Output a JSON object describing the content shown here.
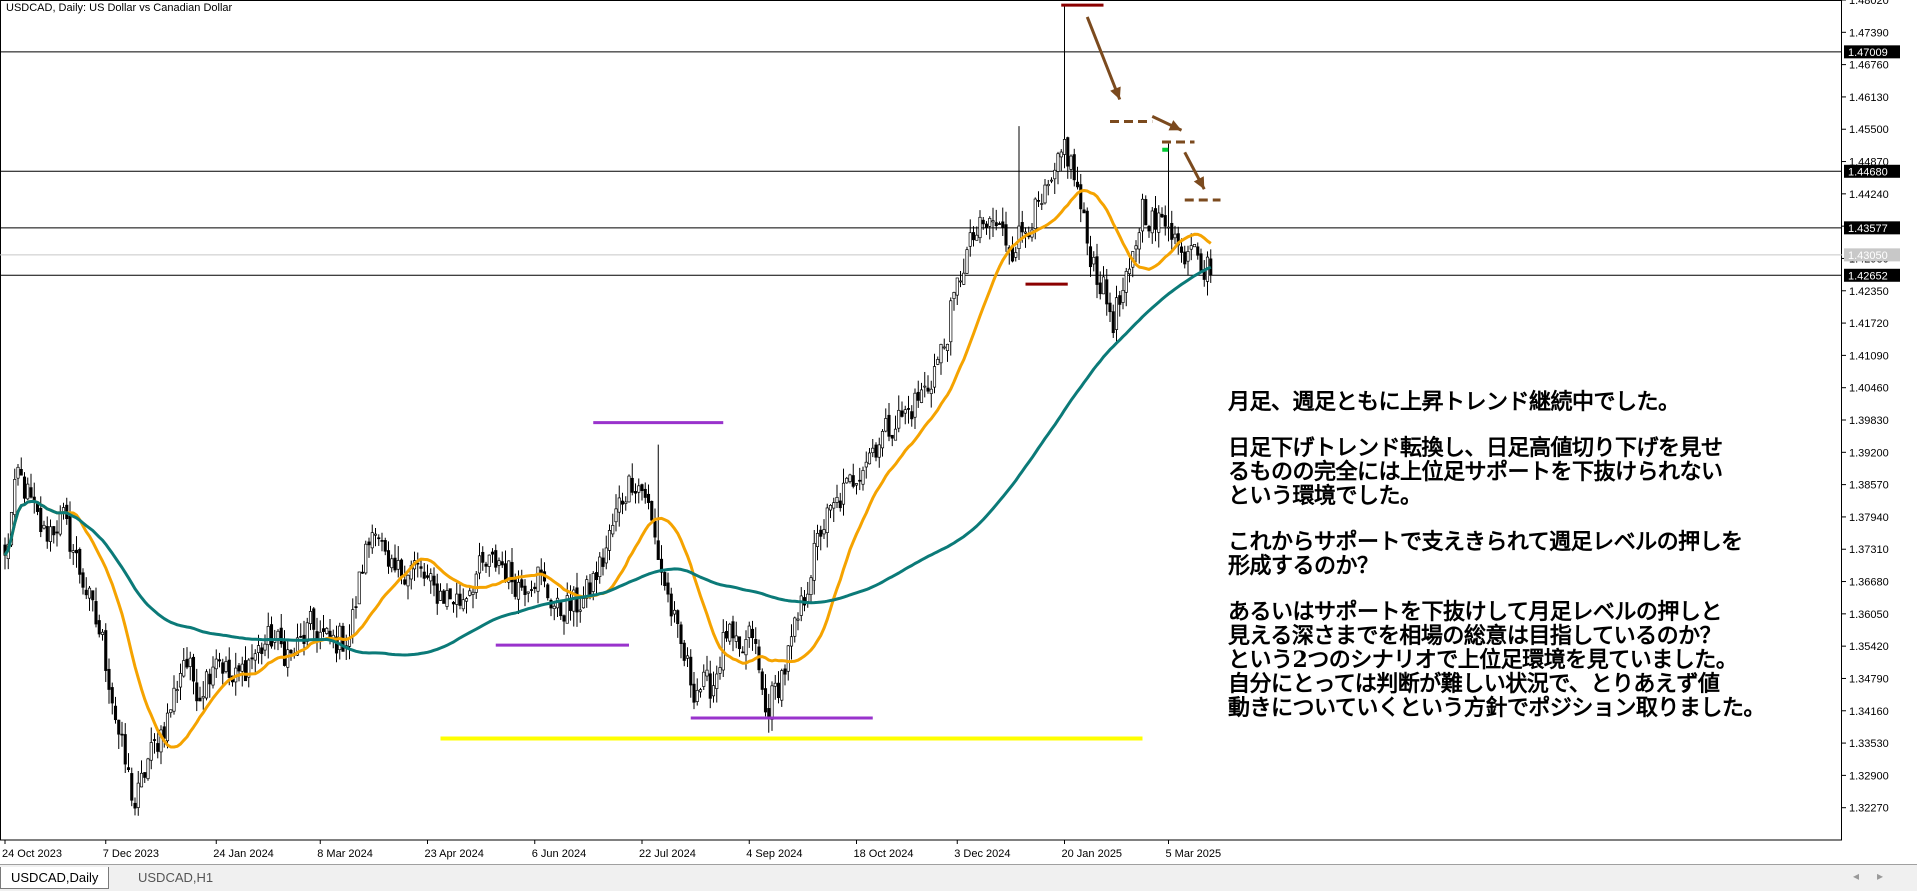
{
  "window": {
    "title": "USDCAD, Daily:  US Dollar vs Canadian Dollar"
  },
  "tabs": [
    {
      "label": "USDCAD,Daily",
      "active": true
    },
    {
      "label": "USDCAD,H1",
      "active": false
    }
  ],
  "memo": {
    "paragraphs": [
      [
        "月足、週足ともに上昇トレンド継続中でした。"
      ],
      [
        "日足下げトレンド転換し、日足高値切り下げを見せ",
        "るものの完全には上位足サポートを下抜けられない",
        "という環境でした。"
      ],
      [
        "これからサポートで支えきられて週足レベルの押しを",
        "形成するのか？"
      ],
      [
        "あるいはサポートを下抜けして月足レベルの押しと",
        "見える深さまでを相場の総意は目指しているのか？",
        "という2つのシナリオで上位足環境を見ていました。",
        "自分にとっては判断が難しい状況で、とりあえず値",
        "動きについていくという方針でポジション取りました。"
      ]
    ]
  },
  "colors": {
    "bull": "#ffffff",
    "bear": "#000000",
    "ma_fast": "#f5a300",
    "ma_slow": "#0b7a78",
    "support_yellow": "#ffff00",
    "range_purple": "#9933cc",
    "peak_red": "#8b0000",
    "arrow_brown": "#7b4a1e",
    "current_marker": "#00cc33"
  },
  "chart_data": {
    "type": "candlestick",
    "symbol": "USDCAD",
    "timeframe": "Daily",
    "ylim": [
      1.3164,
      1.4802
    ],
    "y_ticks": [
      1.4802,
      1.4739,
      1.4676,
      1.4613,
      1.455,
      1.4487,
      1.4424,
      1.4361,
      1.4298,
      1.4235,
      1.4172,
      1.4109,
      1.4046,
      1.3983,
      1.392,
      1.3857,
      1.3794,
      1.3731,
      1.3668,
      1.3605,
      1.3542,
      1.3479,
      1.3416,
      1.3353,
      1.329,
      1.3227
    ],
    "y_tick_labels": [
      "1.48020",
      "1.47390",
      "1.46760",
      "1.46130",
      "1.45500",
      "1.44870",
      "1.44240",
      "1.43610",
      "1.42980",
      "1.42350",
      "1.41720",
      "1.41090",
      "1.40460",
      "1.39830",
      "1.39200",
      "1.38570",
      "1.37940",
      "1.37310",
      "1.36680",
      "1.36050",
      "1.35420",
      "1.34790",
      "1.34160",
      "1.33530",
      "1.32900",
      "1.32270"
    ],
    "x_tick_labels": [
      "24 Oct 2023",
      "7 Dec 2023",
      "24 Jan 2024",
      "8 Mar 2024",
      "23 Apr 2024",
      "6 Jun 2024",
      "22 Jul 2024",
      "4 Sep 2024",
      "18 Oct 2024",
      "3 Dec 2024",
      "20 Jan 2025",
      "5 Mar 2025"
    ],
    "x_tick_index": [
      0,
      31,
      65,
      97,
      130,
      163,
      196,
      229,
      262,
      293,
      326,
      358
    ],
    "total_bars": 430,
    "waypoints": [
      [
        0,
        1.371
      ],
      [
        4,
        1.388
      ],
      [
        12,
        1.376
      ],
      [
        18,
        1.379
      ],
      [
        24,
        1.367
      ],
      [
        30,
        1.355
      ],
      [
        35,
        1.337
      ],
      [
        40,
        1.323
      ],
      [
        44,
        1.332
      ],
      [
        50,
        1.34
      ],
      [
        55,
        1.352
      ],
      [
        60,
        1.345
      ],
      [
        65,
        1.353
      ],
      [
        70,
        1.347
      ],
      [
        76,
        1.352
      ],
      [
        82,
        1.356
      ],
      [
        88,
        1.352
      ],
      [
        94,
        1.358
      ],
      [
        100,
        1.355
      ],
      [
        106,
        1.356
      ],
      [
        110,
        1.37
      ],
      [
        114,
        1.379
      ],
      [
        118,
        1.368
      ],
      [
        126,
        1.37
      ],
      [
        132,
        1.365
      ],
      [
        140,
        1.363
      ],
      [
        146,
        1.369
      ],
      [
        152,
        1.371
      ],
      [
        158,
        1.366
      ],
      [
        164,
        1.368
      ],
      [
        170,
        1.361
      ],
      [
        178,
        1.363
      ],
      [
        184,
        1.371
      ],
      [
        189,
        1.382
      ],
      [
        193,
        1.387
      ],
      [
        197,
        1.384
      ],
      [
        202,
        1.369
      ],
      [
        207,
        1.356
      ],
      [
        212,
        1.346
      ],
      [
        218,
        1.347
      ],
      [
        222,
        1.357
      ],
      [
        226,
        1.352
      ],
      [
        230,
        1.357
      ],
      [
        234,
        1.341
      ],
      [
        240,
        1.35
      ],
      [
        246,
        1.364
      ],
      [
        251,
        1.377
      ],
      [
        256,
        1.382
      ],
      [
        261,
        1.387
      ],
      [
        266,
        1.392
      ],
      [
        272,
        1.397
      ],
      [
        278,
        1.4
      ],
      [
        284,
        1.405
      ],
      [
        289,
        1.413
      ],
      [
        294,
        1.427
      ],
      [
        298,
        1.434
      ],
      [
        304,
        1.437
      ],
      [
        310,
        1.432
      ],
      [
        315,
        1.437
      ],
      [
        319,
        1.44
      ],
      [
        323,
        1.445
      ],
      [
        326,
        1.452
      ],
      [
        329,
        1.446
      ],
      [
        333,
        1.433
      ],
      [
        337,
        1.425
      ],
      [
        341,
        1.418
      ],
      [
        346,
        1.426
      ],
      [
        350,
        1.44
      ],
      [
        354,
        1.436
      ],
      [
        358,
        1.438
      ],
      [
        362,
        1.43
      ],
      [
        366,
        1.435
      ],
      [
        369,
        1.427
      ],
      [
        371,
        1.429
      ]
    ],
    "spikes": [
      {
        "bar": 326,
        "high": 1.4792
      },
      {
        "bar": 312,
        "high": 1.4556
      },
      {
        "bar": 358,
        "high": 1.4522
      },
      {
        "bar": 201,
        "high": 1.3935
      }
    ],
    "price_level_labels": [
      {
        "price": 1.47009,
        "label": "1.47009"
      },
      {
        "price": 1.4468,
        "label": "1.44680"
      },
      {
        "price": 1.43577,
        "label": "1.43577"
      },
      {
        "price": 1.4305,
        "label": "1.43050",
        "current": true
      },
      {
        "price": 1.42652,
        "label": "1.42652"
      }
    ],
    "annotations": {
      "purple_segments": [
        {
          "start": 181,
          "end": 221,
          "price": 1.3978
        },
        {
          "start": 151,
          "end": 192,
          "price": 1.3544
        },
        {
          "start": 211,
          "end": 267,
          "price": 1.3402
        }
      ],
      "yellow_segment": {
        "start": 134,
        "end": 350,
        "price": 1.3362
      },
      "red_segments": [
        {
          "start": 325,
          "end": 338,
          "price": 1.4792
        },
        {
          "start": 314,
          "end": 327,
          "price": 1.4248
        }
      ],
      "dashed_segments": [
        {
          "start": 340,
          "end": 353,
          "price": 1.4565
        },
        {
          "start": 356,
          "end": 366,
          "price": 1.4525
        },
        {
          "start": 363,
          "end": 374,
          "price": 1.4412
        }
      ],
      "arrows": [
        {
          "from": [
            333,
            1.4769
          ],
          "to": [
            343,
            1.4608
          ]
        },
        {
          "from": [
            353,
            1.4575
          ],
          "to": [
            362,
            1.4548
          ]
        },
        {
          "from": [
            363,
            1.4505
          ],
          "to": [
            369,
            1.4433
          ]
        }
      ],
      "current_marker": {
        "bar": 357,
        "price": 1.451
      }
    }
  }
}
